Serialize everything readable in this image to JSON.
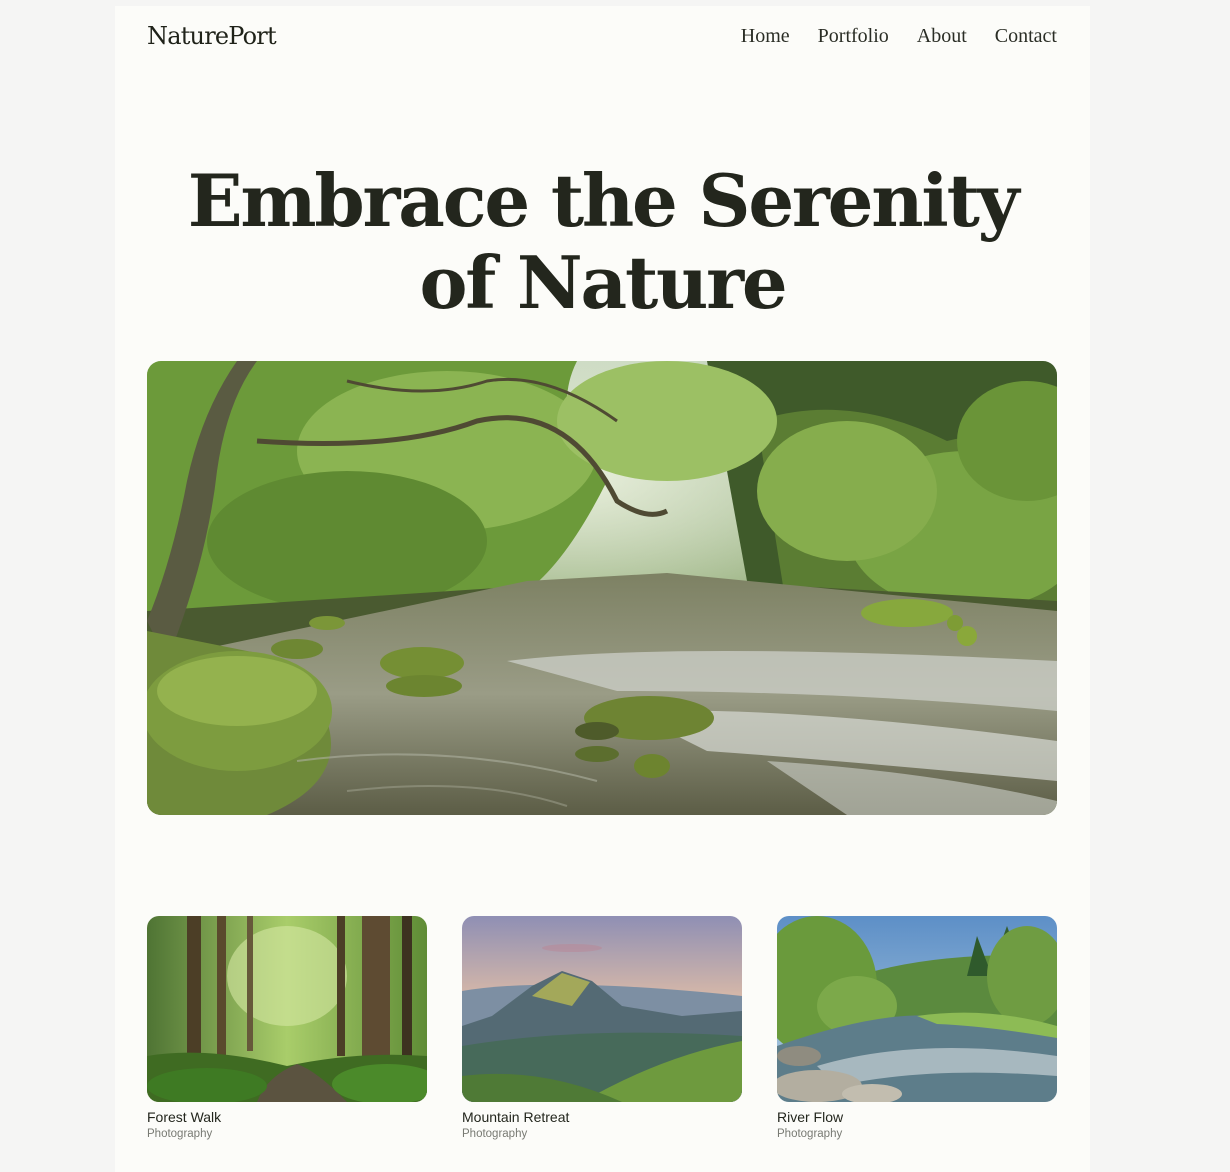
{
  "brand": {
    "name": "NaturePort"
  },
  "nav": {
    "items": [
      {
        "label": "Home"
      },
      {
        "label": "Portfolio"
      },
      {
        "label": "About"
      },
      {
        "label": "Contact"
      }
    ]
  },
  "hero": {
    "title_line1": "Embrace the Serenity",
    "title_line2": "of Nature",
    "image": "forest-river-photo"
  },
  "gallery": {
    "items": [
      {
        "title": "Forest Walk",
        "category": "Photography",
        "image": "forest-path-photo"
      },
      {
        "title": "Mountain Retreat",
        "category": "Photography",
        "image": "mountain-sunset-photo"
      },
      {
        "title": "River Flow",
        "category": "Photography",
        "image": "river-valley-photo"
      }
    ]
  },
  "colors": {
    "page_background": "#f5f5f4",
    "content_background": "#fcfcf9",
    "text": "#23261d",
    "muted_text": "#787a73"
  }
}
